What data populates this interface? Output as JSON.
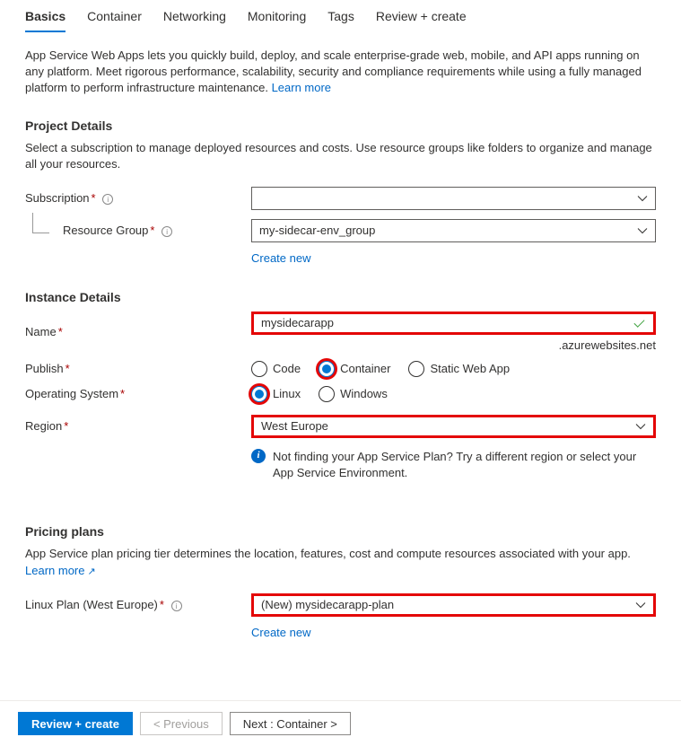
{
  "tabs": {
    "basics": "Basics",
    "container": "Container",
    "networking": "Networking",
    "monitoring": "Monitoring",
    "tags": "Tags",
    "review": "Review + create"
  },
  "intro": {
    "text": "App Service Web Apps lets you quickly build, deploy, and scale enterprise-grade web, mobile, and API apps running on any platform. Meet rigorous performance, scalability, security and compliance requirements while using a fully managed platform to perform infrastructure maintenance.  ",
    "learn_more": "Learn more"
  },
  "project": {
    "heading": "Project Details",
    "desc": "Select a subscription to manage deployed resources and costs. Use resource groups like folders to organize and manage all your resources.",
    "subscription_label": "Subscription",
    "subscription_value": "",
    "rg_label": "Resource Group",
    "rg_value": "my-sidecar-env_group",
    "create_new": "Create new"
  },
  "instance": {
    "heading": "Instance Details",
    "name_label": "Name",
    "name_value": "mysidecarapp",
    "name_suffix": ".azurewebsites.net",
    "publish_label": "Publish",
    "publish_options": {
      "code": "Code",
      "container": "Container",
      "static": "Static Web App"
    },
    "os_label": "Operating System",
    "os_options": {
      "linux": "Linux",
      "windows": "Windows"
    },
    "region_label": "Region",
    "region_value": "West Europe",
    "region_info": "Not finding your App Service Plan? Try a different region or select your App Service Environment."
  },
  "pricing": {
    "heading": "Pricing plans",
    "desc_a": "App Service plan pricing tier determines the location, features, cost and compute resources associated with your app. ",
    "learn_more": "Learn more",
    "plan_label": "Linux Plan (West Europe)",
    "plan_value": "(New) mysidecarapp-plan",
    "create_new": "Create new"
  },
  "footer": {
    "review": "Review + create",
    "previous": "< Previous",
    "next": "Next : Container >"
  }
}
